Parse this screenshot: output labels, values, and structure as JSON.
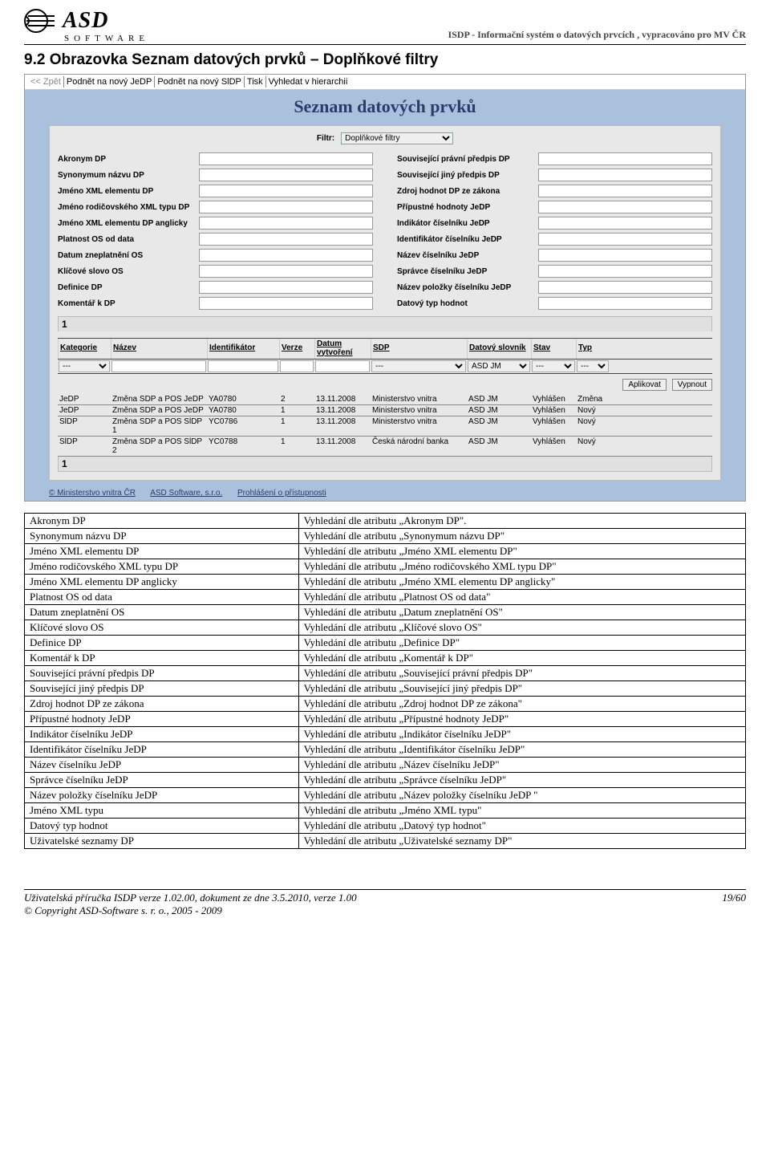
{
  "header": {
    "logo_text": "ASD",
    "logo_sub": "SOFTWARE",
    "right_text": "ISDP - Informační systém o datových prvcích , vypracováno pro MV ČR"
  },
  "section_title": "9.2  Obrazovka Seznam datových prvků – Doplňkové filtry",
  "ss": {
    "menu": [
      "<< Zpět",
      "Podnět na nový JeDP",
      "Podnět na nový SlDP",
      "Tisk",
      "Vyhledat v hierarchii"
    ],
    "title": "Seznam datových prvků",
    "filtr_label": "Filtr:",
    "filtr_value": "Doplňkové filtry",
    "fields_left": [
      "Akronym DP",
      "Synonymum názvu DP",
      "Jméno XML elementu DP",
      "Jméno rodičovského XML typu DP",
      "Jméno XML elementu DP anglicky",
      "Platnost OS od data",
      "Datum zneplatnění OS",
      "Klíčové slovo OS",
      "Definice DP",
      "Komentář k DP"
    ],
    "fields_right": [
      "Související právní předpis DP",
      "Související jiný předpis DP",
      "Zdroj hodnot DP ze zákona",
      "Přípustné hodnoty JeDP",
      "Indikátor číselníku JeDP",
      "Identifikátor číselníku JeDP",
      "Název číselníku JeDP",
      "Správce číselníku JeDP",
      "Název položky číselníku JeDP",
      "Datový typ hodnot"
    ],
    "grid_headers": [
      "Kategorie",
      "Název",
      "Identifikátor",
      "Verze",
      "Datum vytvoření",
      "SDP",
      "Datový slovník",
      "Stav",
      "Typ"
    ],
    "grid_filter_dashes": "---",
    "grid_filter_asdjm": "ASD JM",
    "btn_aplikovat": "Aplikovat",
    "btn_vypnout": "Vypnout",
    "rows": [
      {
        "kat": "JeDP",
        "naz": "Změna SDP a POS JeDP",
        "id": "YA0780",
        "ver": "2",
        "dat": "13.11.2008",
        "sdp": "Ministerstvo vnitra",
        "slov": "ASD JM",
        "stav": "Vyhlášen",
        "typ": "Změna"
      },
      {
        "kat": "JeDP",
        "naz": "Změna SDP a POS JeDP",
        "id": "YA0780",
        "ver": "1",
        "dat": "13.11.2008",
        "sdp": "Ministerstvo vnitra",
        "slov": "ASD JM",
        "stav": "Vyhlášen",
        "typ": "Nový"
      },
      {
        "kat": "SlDP",
        "naz": "Změna SDP a POS SlDP 1",
        "id": "YC0786",
        "ver": "1",
        "dat": "13.11.2008",
        "sdp": "Ministerstvo vnitra",
        "slov": "ASD JM",
        "stav": "Vyhlášen",
        "typ": "Nový"
      },
      {
        "kat": "SlDP",
        "naz": "Změna SDP a POS SlDP 2",
        "id": "YC0788",
        "ver": "1",
        "dat": "13.11.2008",
        "sdp": "Česká národní banka",
        "slov": "ASD JM",
        "stav": "Vyhlášen",
        "typ": "Nový"
      }
    ],
    "counter": "1",
    "footer_links": [
      "© Ministerstvo vnitra ČR",
      "ASD Software, s.r.o.",
      "Prohlášení o přístupnosti"
    ]
  },
  "definitions": [
    [
      "Akronym DP",
      "Vyhledání dle atributu „Akronym DP\"."
    ],
    [
      "Synonymum názvu DP",
      "Vyhledání dle atributu „Synonymum názvu DP\""
    ],
    [
      "Jméno XML elementu DP",
      "Vyhledání dle atributu „Jméno XML elementu DP\""
    ],
    [
      "Jméno rodičovského XML typu DP",
      "Vyhledání dle atributu „Jméno rodičovského XML typu DP\""
    ],
    [
      "Jméno XML elementu DP anglicky",
      "Vyhledání dle atributu „Jméno XML elementu DP anglicky\""
    ],
    [
      "Platnost OS od data",
      "Vyhledání dle atributu „Platnost OS od data\""
    ],
    [
      "Datum zneplatnění OS",
      "Vyhledání dle atributu „Datum zneplatnění OS\""
    ],
    [
      "Klíčové slovo OS",
      "Vyhledání dle atributu „Klíčové slovo OS\""
    ],
    [
      "Definice DP",
      "Vyhledání dle atributu „Definice DP\""
    ],
    [
      "Komentář k DP",
      "Vyhledání dle atributu „Komentář k DP\""
    ],
    [
      "Související právní předpis DP",
      "Vyhledání dle atributu „Související právní předpis DP\""
    ],
    [
      "Související jiný předpis DP",
      "Vyhledání dle atributu „Související jiný předpis DP\""
    ],
    [
      "Zdroj hodnot DP ze zákona",
      "Vyhledání dle atributu „Zdroj hodnot DP ze zákona\""
    ],
    [
      "Přípustné hodnoty JeDP",
      "Vyhledání dle atributu „Přípustné hodnoty JeDP\""
    ],
    [
      "Indikátor číselníku JeDP",
      "Vyhledání dle atributu „Indikátor číselníku JeDP\""
    ],
    [
      "Identifikátor číselníku JeDP",
      "Vyhledání dle atributu „Identifikátor číselníku JeDP\""
    ],
    [
      "Název číselníku JeDP",
      "Vyhledání dle atributu „Název číselníku JeDP\""
    ],
    [
      "Správce číselníku JeDP",
      "Vyhledání dle atributu „Správce číselníku JeDP\""
    ],
    [
      "Název položky číselníku JeDP",
      "Vyhledání dle atributu „Název položky číselníku JeDP \""
    ],
    [
      "Jméno XML typu",
      "Vyhledání dle atributu „Jméno XML typu\""
    ],
    [
      "Datový typ hodnot",
      "Vyhledání dle atributu „Datový typ hodnot\""
    ],
    [
      "Uživatelské seznamy DP",
      "Vyhledání dle atributu „Uživatelské seznamy DP\""
    ]
  ],
  "footer": {
    "left1": "Uživatelská  příručka ISDP verze 1.02.00, dokument ze dne 3.5.2010, verze 1.00",
    "left2": "© Copyright ASD-Software s. r. o., 2005 - 2009",
    "right": "19/60"
  }
}
